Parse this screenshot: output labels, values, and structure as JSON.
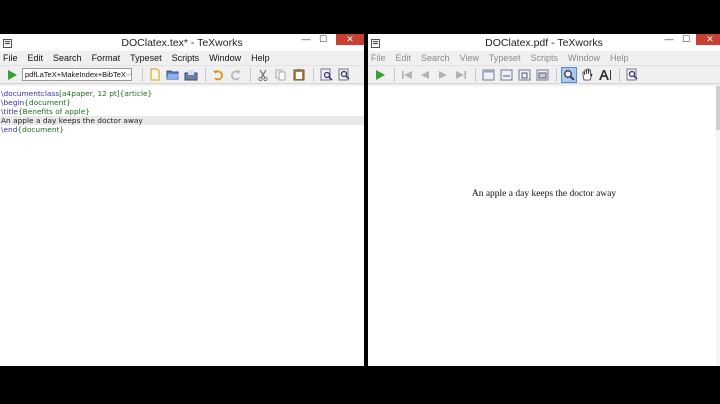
{
  "editor_window": {
    "title": "DOClatex.tex* - TeXworks",
    "controls": {
      "minimize": "—",
      "maximize": "☐",
      "close": "✕"
    },
    "menu": [
      "File",
      "Edit",
      "Search",
      "Format",
      "Typeset",
      "Scripts",
      "Window",
      "Help"
    ],
    "typeset_engine": "pdfLaTeX+MakeIndex+BibTeX",
    "source_lines": [
      {
        "cmd": "\\documentclass",
        "arg": "[a4paper, 12 pt]{article}"
      },
      {
        "cmd": "\\begin",
        "arg": "{document}"
      },
      {
        "cmd": "\\title",
        "arg": "{Benefits of apple}"
      },
      {
        "text": "An apple a day keeps the doctor away"
      },
      {
        "cmd": "\\end",
        "arg": "{document}"
      }
    ]
  },
  "preview_window": {
    "title": "DOClatex.pdf - TeXworks",
    "controls": {
      "minimize": "—",
      "maximize": "☐",
      "close": "✕"
    },
    "menu": [
      "File",
      "Edit",
      "Search",
      "View",
      "Typeset",
      "Scripts",
      "Window",
      "Help"
    ],
    "pdf_text": "An apple a day keeps the doctor away"
  },
  "colors": {
    "run_green": "#2ea42e",
    "close_red": "#c84031",
    "command_purple": "#3c2fa0",
    "argument_green": "#1f6b1f"
  }
}
